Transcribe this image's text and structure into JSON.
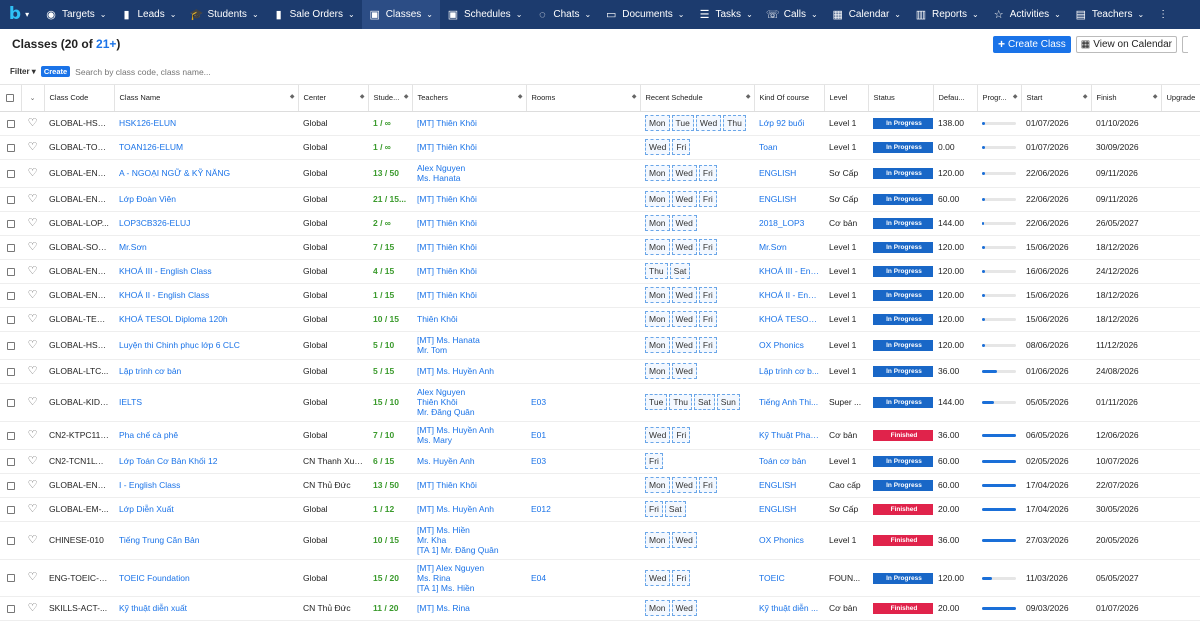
{
  "nav": {
    "items": [
      {
        "label": "Targets",
        "icon": "target-icon",
        "glyph": "◉"
      },
      {
        "label": "Leads",
        "icon": "leads-icon",
        "glyph": "▮"
      },
      {
        "label": "Students",
        "icon": "graduation-cap-icon",
        "glyph": "🎓"
      },
      {
        "label": "Sale Orders",
        "icon": "sale-orders-icon",
        "glyph": "▮"
      },
      {
        "label": "Classes",
        "icon": "classes-icon",
        "glyph": "▣"
      },
      {
        "label": "Schedules",
        "icon": "calendar-check-icon",
        "glyph": "▣"
      },
      {
        "label": "Chats",
        "icon": "chat-icon",
        "glyph": "◌"
      },
      {
        "label": "Documents",
        "icon": "document-icon",
        "glyph": "▭"
      },
      {
        "label": "Tasks",
        "icon": "tasks-icon",
        "glyph": "☰"
      },
      {
        "label": "Calls",
        "icon": "phone-icon",
        "glyph": "☏"
      },
      {
        "label": "Calendar",
        "icon": "calendar-icon",
        "glyph": "▦"
      },
      {
        "label": "Reports",
        "icon": "chart-icon",
        "glyph": "▥"
      },
      {
        "label": "Activities",
        "icon": "star-icon",
        "glyph": "☆"
      },
      {
        "label": "Teachers",
        "icon": "teacher-icon",
        "glyph": "▤"
      }
    ],
    "active": "Classes",
    "more": "⋮"
  },
  "header": {
    "title_prefix": "Classes (20 of ",
    "title_more": "21+",
    "title_suffix": ")",
    "create_label": "Create Class",
    "view_calendar_label": "View on Calendar"
  },
  "filterbar": {
    "filter_label": "Filter",
    "create_label": "Create",
    "search_placeholder": "Search by class code, class name..."
  },
  "columns": [
    "Class Code",
    "Class Name",
    "Center",
    "Stude...",
    "Teachers",
    "Rooms",
    "Recent Schedule",
    "Kind Of course",
    "Level",
    "Status",
    "Defau...",
    "Progr...",
    "Start",
    "Finish",
    "Upgrade"
  ],
  "colors": {
    "in_progress": "#1967c7",
    "finished": "#e0234b",
    "nav_bg": "#1c3b6e"
  },
  "rows": [
    {
      "code": "GLOBAL-HSK...",
      "name": "HSK126-ELUN",
      "center": "Global",
      "students": "1 / ∞",
      "teachers": [
        "[MT] Thiên Khôi"
      ],
      "rooms": "",
      "days": [
        "Mon",
        "Tue",
        "Wed",
        "Thu"
      ],
      "kind": "Lớp 92 buổi",
      "level": "Level 1",
      "status": "In Progress",
      "fee": "138.00",
      "progress": 0.08,
      "start": "01/07/2026",
      "finish": "01/10/2026"
    },
    {
      "code": "GLOBAL-TOA...",
      "name": "TOAN126-ELUM",
      "center": "Global",
      "students": "1 / ∞",
      "teachers": [
        "[MT] Thiên Khôi"
      ],
      "rooms": "",
      "days": [
        "Wed",
        "Fri"
      ],
      "kind": "Toan",
      "level": "Level 1",
      "status": "In Progress",
      "fee": "0.00",
      "progress": 0.08,
      "start": "01/07/2026",
      "finish": "30/09/2026"
    },
    {
      "code": "GLOBAL-ENG...",
      "name": "A - NGOẠI NGỮ & KỸ NĂNG",
      "center": "Global",
      "students": "13 / 50",
      "teachers": [
        "Alex Nguyen",
        "Ms. Hanata"
      ],
      "rooms": "",
      "days": [
        "Mon",
        "Wed",
        "Fri"
      ],
      "kind": "ENGLISH",
      "level": "Sơ Cấp",
      "status": "In Progress",
      "fee": "120.00",
      "progress": 0.08,
      "start": "22/06/2026",
      "finish": "09/11/2026"
    },
    {
      "code": "GLOBAL-ENG...",
      "name": "Lớp Đoàn Viên",
      "center": "Global",
      "students": "21 / 15...",
      "teachers": [
        "[MT] Thiên Khôi"
      ],
      "rooms": "",
      "days": [
        "Mon",
        "Wed",
        "Fri"
      ],
      "kind": "ENGLISH",
      "level": "Sơ Cấp",
      "status": "In Progress",
      "fee": "60.00",
      "progress": 0.08,
      "start": "22/06/2026",
      "finish": "09/11/2026"
    },
    {
      "code": "GLOBAL-LOP...",
      "name": "LOP3CB326-ELUJ",
      "center": "Global",
      "students": "2 / ∞",
      "teachers": [
        "[MT] Thiên Khôi"
      ],
      "rooms": "",
      "days": [
        "Mon",
        "Wed"
      ],
      "kind": "2018_LOP3",
      "level": "Cơ bản",
      "status": "In Progress",
      "fee": "144.00",
      "progress": 0.05,
      "start": "22/06/2026",
      "finish": "26/05/2027"
    },
    {
      "code": "GLOBAL-SON...",
      "name": "Mr.Sơn",
      "center": "Global",
      "students": "7 / 15",
      "teachers": [
        "[MT] Thiên Khôi"
      ],
      "rooms": "",
      "days": [
        "Mon",
        "Wed",
        "Fri"
      ],
      "kind": "Mr.Sơn",
      "level": "Level 1",
      "status": "In Progress",
      "fee": "120.00",
      "progress": 0.08,
      "start": "15/06/2026",
      "finish": "18/12/2026"
    },
    {
      "code": "GLOBAL-ENG...",
      "name": "KHOÁ III - English Class",
      "center": "Global",
      "students": "4 / 15",
      "teachers": [
        "[MT] Thiên Khôi"
      ],
      "rooms": "",
      "days": [
        "Thu",
        "Sat"
      ],
      "kind": "KHOÁ III - Eng...",
      "level": "Level 1",
      "status": "In Progress",
      "fee": "120.00",
      "progress": 0.08,
      "start": "16/06/2026",
      "finish": "24/12/2026"
    },
    {
      "code": "GLOBAL-ENG...",
      "name": "KHOÁ II - English Class",
      "center": "Global",
      "students": "1 / 15",
      "teachers": [
        "[MT] Thiên Khôi"
      ],
      "rooms": "",
      "days": [
        "Mon",
        "Wed",
        "Fri"
      ],
      "kind": "KHOÁ II - Engl...",
      "level": "Level 1",
      "status": "In Progress",
      "fee": "120.00",
      "progress": 0.08,
      "start": "15/06/2026",
      "finish": "18/12/2026"
    },
    {
      "code": "GLOBAL-TES-...",
      "name": "KHOÁ TESOL Diploma 120h",
      "center": "Global",
      "students": "10 / 15",
      "teachers": [
        "Thiên Khôi"
      ],
      "rooms": "",
      "days": [
        "Mon",
        "Wed",
        "Fri"
      ],
      "kind": "KHOÁ TESOL ...",
      "level": "Level 1",
      "status": "In Progress",
      "fee": "120.00",
      "progress": 0.08,
      "start": "15/06/2026",
      "finish": "18/12/2026"
    },
    {
      "code": "GLOBAL-HSK...",
      "name": "Luyện thi Chinh phục lớp 6 CLC",
      "center": "Global",
      "students": "5 / 10",
      "teachers": [
        "[MT] Ms. Hanata",
        "Mr. Tom"
      ],
      "rooms": "",
      "days": [
        "Mon",
        "Wed",
        "Fri"
      ],
      "kind": "OX Phonics",
      "level": "Level 1",
      "status": "In Progress",
      "fee": "120.00",
      "progress": 0.1,
      "start": "08/06/2026",
      "finish": "11/12/2026"
    },
    {
      "code": "GLOBAL-LTC...",
      "name": "Lập trình cơ bản",
      "center": "Global",
      "students": "5 / 15",
      "teachers": [
        "[MT] Ms. Huyền Anh"
      ],
      "rooms": "",
      "days": [
        "Mon",
        "Wed"
      ],
      "kind": "Lập trình cơ b...",
      "level": "Level 1",
      "status": "In Progress",
      "fee": "36.00",
      "progress": 0.45,
      "start": "01/06/2026",
      "finish": "24/08/2026"
    },
    {
      "code": "GLOBAL-KIDS...",
      "name": "IELTS",
      "center": "Global",
      "students": "15 / 10",
      "teachers": [
        "Alex Nguyen",
        "Thiên Khôi",
        "Mr. Đăng Quân"
      ],
      "rooms": "E03",
      "days": [
        "Tue",
        "Thu",
        "Sat",
        "Sun"
      ],
      "kind": "Tiếng Anh Thi...",
      "level": "Super ...",
      "status": "In Progress",
      "fee": "144.00",
      "progress": 0.35,
      "start": "05/05/2026",
      "finish": "01/11/2026"
    },
    {
      "code": "CN2-KTPC112...",
      "name": "Pha chế cà phê",
      "center": "Global",
      "students": "7 / 10",
      "teachers": [
        "[MT] Ms. Huyền Anh",
        "Ms. Mary"
      ],
      "rooms": "E01",
      "days": [
        "Wed",
        "Fri"
      ],
      "kind": "Kỹ Thuật Pha ...",
      "level": "Cơ bản",
      "status": "Finished",
      "fee": "36.00",
      "progress": 1,
      "start": "06/05/2026",
      "finish": "12/06/2026"
    },
    {
      "code": "CN2-TCN1LV1...",
      "name": "Lớp Toán Cơ Bản Khối 12",
      "center": "CN Thanh Xuân",
      "students": "6 / 15",
      "teachers": [
        "Ms. Huyền Anh"
      ],
      "rooms": "E03",
      "days": [
        "Fri"
      ],
      "kind": "Toán cơ bản",
      "level": "Level 1",
      "status": "In Progress",
      "fee": "60.00",
      "progress": 1,
      "start": "02/05/2026",
      "finish": "10/07/2026"
    },
    {
      "code": "GLOBAL-ENG...",
      "name": "I - English Class",
      "center": "CN Thủ Đức",
      "students": "13 / 50",
      "teachers": [
        "[MT] Thiên Khôi"
      ],
      "rooms": "",
      "days": [
        "Mon",
        "Wed",
        "Fri"
      ],
      "kind": "ENGLISH",
      "level": "Cao cấp",
      "status": "In Progress",
      "fee": "60.00",
      "progress": 1,
      "start": "17/04/2026",
      "finish": "22/07/2026"
    },
    {
      "code": "GLOBAL-EM-...",
      "name": "Lớp Diễn Xuất",
      "center": "Global",
      "students": "1 / 12",
      "teachers": [
        "[MT] Ms. Huyền Anh"
      ],
      "rooms": "E012",
      "days": [
        "Fri",
        "Sat"
      ],
      "kind": "ENGLISH",
      "level": "Sơ Cấp",
      "status": "Finished",
      "fee": "20.00",
      "progress": 1,
      "start": "17/04/2026",
      "finish": "30/05/2026"
    },
    {
      "code": "CHINESE-010",
      "name": "Tiếng Trung Căn Bản",
      "center": "Global",
      "students": "10 / 15",
      "teachers": [
        "[MT] Ms. Hiền",
        "Mr. Kha",
        "[TA 1] Mr. Đăng Quân"
      ],
      "rooms": "",
      "days": [
        "Mon",
        "Wed"
      ],
      "kind": "OX Phonics",
      "level": "Level 1",
      "status": "Finished",
      "fee": "36.00",
      "progress": 1,
      "start": "27/03/2026",
      "finish": "20/05/2026"
    },
    {
      "code": "ENG-TOEIC-0...",
      "name": "TOEIC Foundation",
      "center": "Global",
      "students": "15 / 20",
      "teachers": [
        "[MT] Alex Nguyen",
        "Ms. Rina",
        "[TA 1] Ms. Hiền"
      ],
      "rooms": "E04",
      "days": [
        "Wed",
        "Fri"
      ],
      "kind": "TOEIC",
      "level": "FOUN...",
      "status": "In Progress",
      "fee": "120.00",
      "progress": 0.3,
      "start": "11/03/2026",
      "finish": "05/05/2027"
    },
    {
      "code": "SKILLS-ACT-...",
      "name": "Kỹ thuật diễn xuất",
      "center": "CN Thủ Đức",
      "students": "11 / 20",
      "teachers": [
        "[MT] Ms. Rina"
      ],
      "rooms": "",
      "days": [
        "Mon",
        "Wed"
      ],
      "kind": "Kỹ thuật diễn ...",
      "level": "Cơ bản",
      "status": "Finished",
      "fee": "20.00",
      "progress": 1,
      "start": "09/03/2026",
      "finish": "01/07/2026"
    }
  ]
}
